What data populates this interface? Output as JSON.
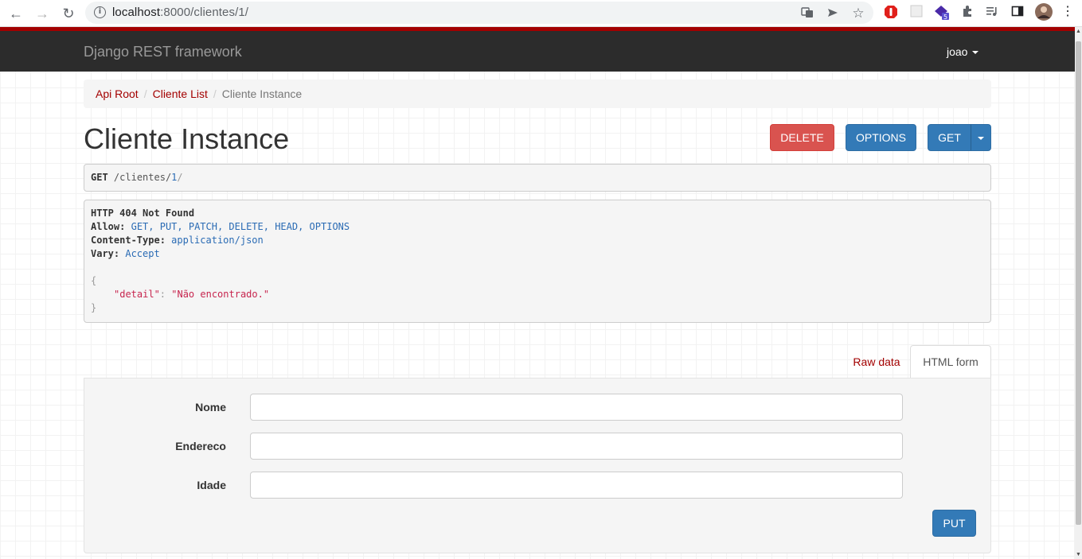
{
  "browser": {
    "url_host": "localhost",
    "url_path": ":8000/clientes/1/",
    "extension_badge": "5"
  },
  "navbar": {
    "brand": "Django REST framework",
    "user": "joao"
  },
  "breadcrumb": {
    "items": [
      "Api Root",
      "Cliente List"
    ],
    "active": "Cliente Instance",
    "separator": "/"
  },
  "page": {
    "title": "Cliente Instance"
  },
  "actions": {
    "delete": "DELETE",
    "options": "OPTIONS",
    "get": "GET"
  },
  "request": {
    "method": "GET",
    "path_prefix": "/clientes/",
    "path_id": "1",
    "path_suffix": "/"
  },
  "response": {
    "status": "HTTP 404 Not Found",
    "allow_key": "Allow:",
    "allow_value": "GET, PUT, PATCH, DELETE, HEAD, OPTIONS",
    "content_type_key": "Content-Type:",
    "content_type_value": "application/json",
    "vary_key": "Vary:",
    "vary_value": "Accept",
    "body_open": "{",
    "body_key": "\"detail\"",
    "body_colon": ": ",
    "body_value": "\"Não encontrado.\"",
    "body_close": "}"
  },
  "tabs": {
    "raw": "Raw data",
    "html": "HTML form"
  },
  "form": {
    "fields": [
      {
        "label": "Nome",
        "value": ""
      },
      {
        "label": "Endereco",
        "value": ""
      },
      {
        "label": "Idade",
        "value": ""
      }
    ],
    "submit": "PUT"
  },
  "colors": {
    "navbar_bg": "#2c2c2c",
    "accent_red": "#a30000",
    "danger": "#d9534f",
    "primary": "#337ab7"
  },
  "icons": [
    "back-icon",
    "forward-icon",
    "reload-icon",
    "info-icon",
    "translate-icon",
    "send-icon",
    "star-icon",
    "extension-icon",
    "puzzle-icon",
    "reading-list-icon",
    "side-panel-icon",
    "avatar"
  ]
}
